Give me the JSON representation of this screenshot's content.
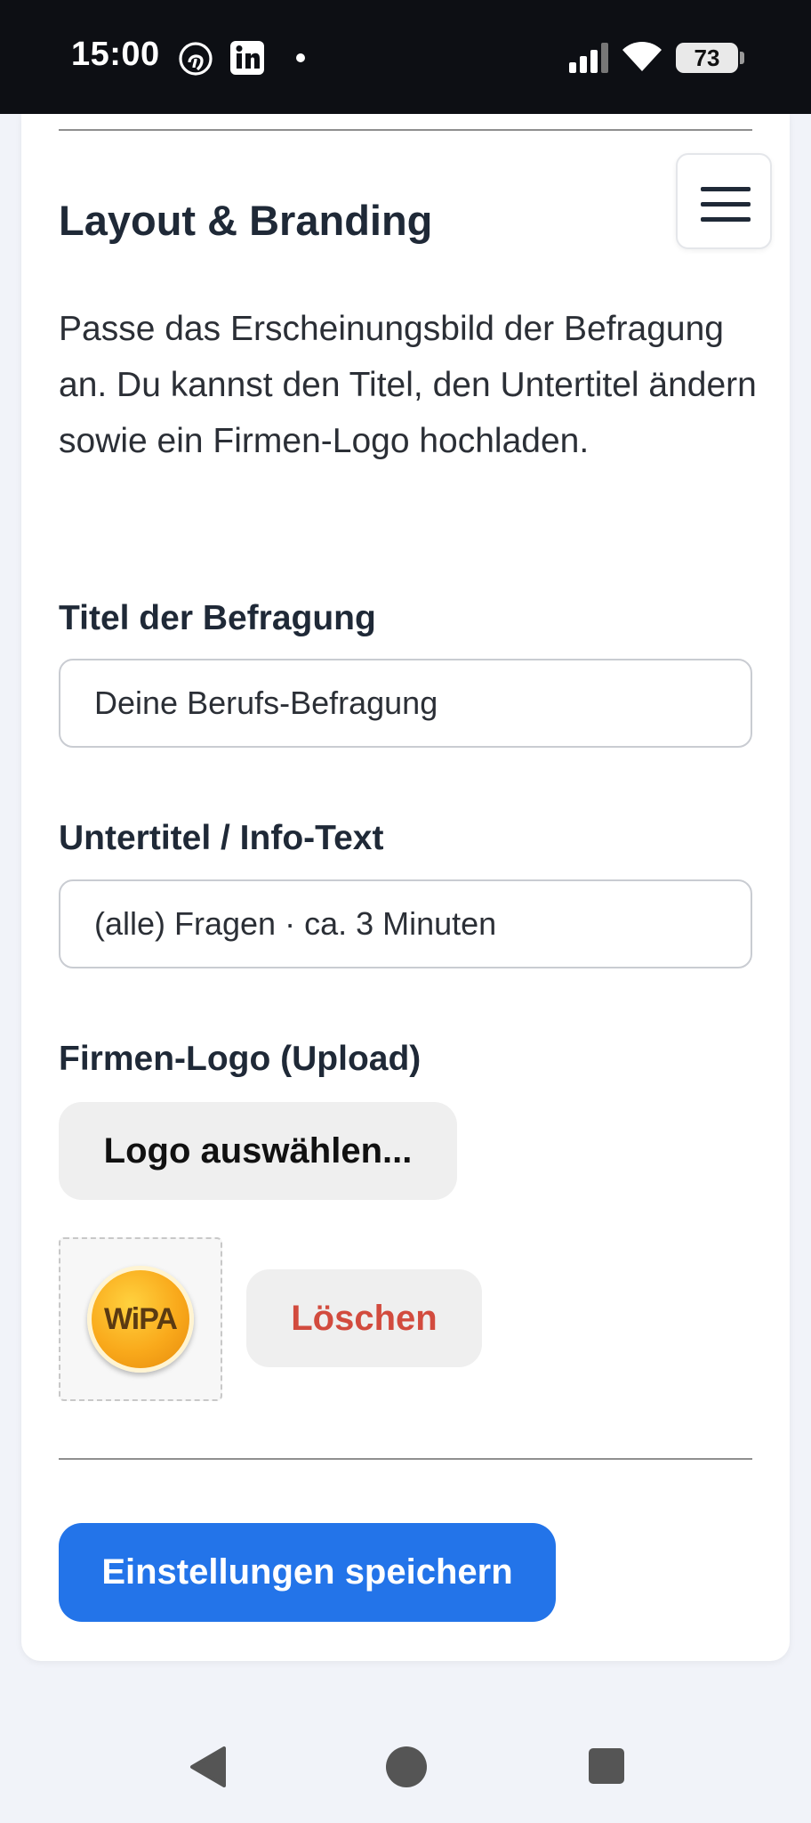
{
  "status_bar": {
    "time": "15:00",
    "icons": [
      "fingerprint-icon",
      "linkedin-icon",
      "dot-icon",
      "signal-icon",
      "wifi-icon",
      "battery-icon"
    ],
    "battery_level": "73"
  },
  "page": {
    "heading": "Layout & Branding",
    "description": "Passe das Erscheinungsbild der Befragung an. Du kannst den Titel, den Untertitel ändern sowie ein Firmen-Logo hochladen."
  },
  "form": {
    "title_label": "Titel der Befragung",
    "title_value": "Deine Berufs-Befragung",
    "subtitle_label": "Untertitel / Info-Text",
    "subtitle_value": "(alle) Fragen · ca. 3 Minuten",
    "logo_label": "Firmen-Logo (Upload)",
    "choose_logo_button": "Logo auswählen...",
    "logo_text": "WiPA",
    "delete_button": "Löschen",
    "save_button": "Einstellungen speichern"
  },
  "colors": {
    "primary": "#2374e9",
    "danger": "#d24b3e",
    "status_bar_bg": "#0d0f14",
    "page_bg": "#f1f3f9"
  },
  "nav_bar": {
    "icons": [
      "back-icon",
      "home-icon",
      "recents-icon"
    ]
  }
}
